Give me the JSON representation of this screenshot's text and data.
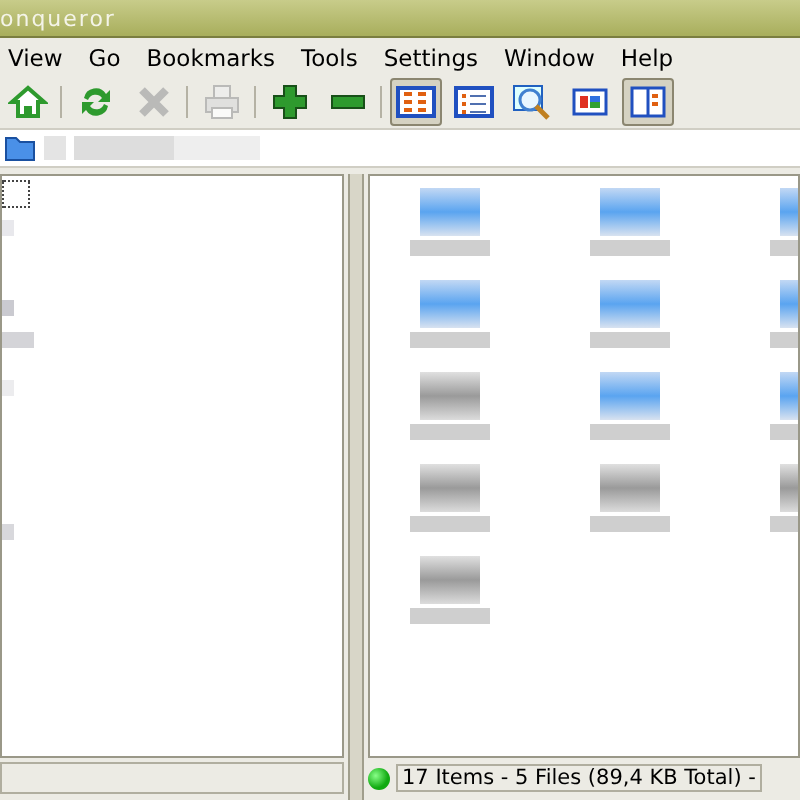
{
  "window": {
    "title": "onqueror"
  },
  "menu": [
    "View",
    "Go",
    "Bookmarks",
    "Tools",
    "Settings",
    "Window",
    "Help"
  ],
  "toolbar": [
    {
      "kind": "home",
      "disabled": false,
      "selected": false
    },
    {
      "kind": "sep"
    },
    {
      "kind": "reload",
      "disabled": false,
      "selected": false
    },
    {
      "kind": "stop",
      "disabled": true,
      "selected": false
    },
    {
      "kind": "sep"
    },
    {
      "kind": "print",
      "disabled": true,
      "selected": false
    },
    {
      "kind": "sep"
    },
    {
      "kind": "zoom-in",
      "disabled": false,
      "selected": false
    },
    {
      "kind": "zoom-out",
      "disabled": false,
      "selected": false
    },
    {
      "kind": "sep"
    },
    {
      "kind": "icon-view",
      "disabled": false,
      "selected": true
    },
    {
      "kind": "list-view",
      "disabled": false,
      "selected": false
    },
    {
      "kind": "find",
      "disabled": false,
      "selected": false
    },
    {
      "kind": "preview",
      "disabled": false,
      "selected": false
    },
    {
      "kind": "split",
      "disabled": false,
      "selected": true
    }
  ],
  "files": [
    {
      "kind": "folder"
    },
    {
      "kind": "folder"
    },
    {
      "kind": "folder"
    },
    {
      "kind": "folder"
    },
    {
      "kind": "folder"
    },
    {
      "kind": "folder"
    },
    {
      "kind": "file"
    },
    {
      "kind": "folder"
    },
    {
      "kind": "folder"
    },
    {
      "kind": "file"
    },
    {
      "kind": "file"
    },
    {
      "kind": "file"
    },
    {
      "kind": "file"
    }
  ],
  "status_bar": {
    "connected": true,
    "text": "17 Items - 5 Files (89,4 KB Total) -"
  }
}
